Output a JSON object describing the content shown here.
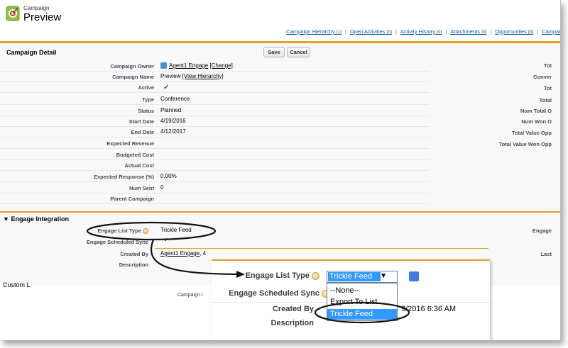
{
  "header": {
    "object_type": "Campaign",
    "title": "Preview",
    "icon": "campaign-target-icon"
  },
  "related_links": [
    {
      "label": "Campaign Hierarchy",
      "count": "[1]"
    },
    {
      "label": "Open Activities",
      "count": "[0]"
    },
    {
      "label": "Activity History",
      "count": "[0]"
    },
    {
      "label": "Attachments",
      "count": "[0]"
    },
    {
      "label": "Opportunities",
      "count": "[0]"
    },
    {
      "label": "Campai",
      "count": ""
    }
  ],
  "detail": {
    "section_title": "Campaign Detail",
    "save_label": "Save",
    "cancel_label": "Cancel",
    "fields": {
      "owner": {
        "label": "Campaign Owner",
        "value": "Agent1 Engage",
        "change": "[Change]"
      },
      "name": {
        "label": "Campaign Name",
        "value": "Preview",
        "view": "[View Hierarchy]"
      },
      "active": {
        "label": "Active",
        "value": "✓"
      },
      "type": {
        "label": "Type",
        "value": "Conference"
      },
      "status": {
        "label": "Status",
        "value": "Planned"
      },
      "start_date": {
        "label": "Start Date",
        "value": "4/19/2016"
      },
      "end_date": {
        "label": "End Date",
        "value": "4/12/2017"
      },
      "expected_revenue": {
        "label": "Expected Revenue",
        "value": ""
      },
      "budgeted_cost": {
        "label": "Budgeted Cost",
        "value": ""
      },
      "actual_cost": {
        "label": "Actual Cost",
        "value": ""
      },
      "expected_response": {
        "label": "Expected Response (%)",
        "value": "0.00%"
      },
      "num_sent": {
        "label": "Num Sent",
        "value": "0"
      },
      "parent_campaign": {
        "label": "Parent Campaign",
        "value": ""
      }
    },
    "right_labels": [
      "Tot",
      "Conver",
      "Tot",
      "Total",
      "Num Total O",
      "Num Won O",
      "Total Value Opp",
      "Total Value Won Opp"
    ]
  },
  "engage": {
    "section_title": "Engage Integration",
    "list_type_label": "Engage List Type",
    "list_type_value": "Trickle Feed",
    "scheduled_sync_label": "Engage Scheduled Sync",
    "scheduled_sync_value": "✓",
    "created_by_label": "Created By",
    "created_by_value": "Agent1 Engage",
    "created_by_suffix": ", 4",
    "description_label": "Description",
    "right_label_1": "Engage",
    "right_label_2": "Last"
  },
  "custom_links": {
    "label": "Custom L",
    "partial": "Campaign I"
  },
  "zoom": {
    "list_type_label": "Engage List Type",
    "scheduled_sync_label": "Engage Scheduled Sync",
    "created_by_label": "Created By",
    "created_by_value_partial": "9/2016 6:36 AM",
    "description_label": "Description",
    "selected_value": "Trickle Feed",
    "options": [
      "--None--",
      "Export To List",
      "Trickle Feed"
    ]
  }
}
